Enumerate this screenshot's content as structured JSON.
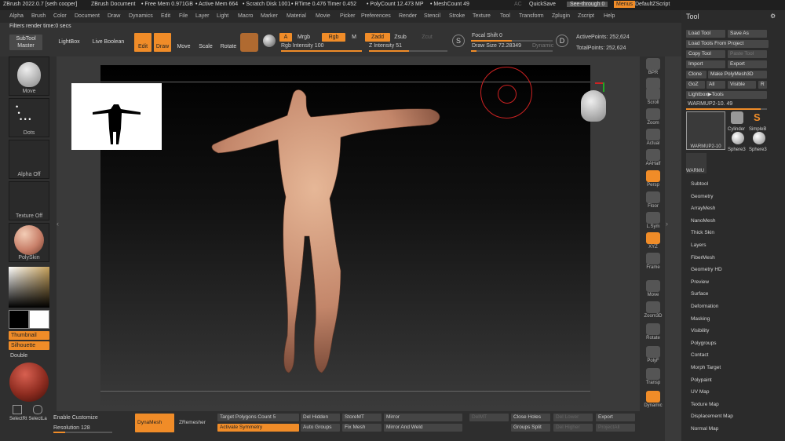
{
  "titlebar": {
    "app": "ZBrush 2022.0.7 [seth cooper]",
    "doc": "ZBrush Document",
    "free_mem": "• Free Mem 0.971GB",
    "active_mem": "• Active Mem 664",
    "scratch": "• Scratch Disk 1001",
    "rtime": "• RTime 0.476 Timer 0.452",
    "polycount": "• PolyCount 12.473 MP",
    "meshcount": "• MeshCount 49",
    "ac": "AC",
    "quicksave": "QuickSave",
    "seethrough": "See-through  0",
    "menus": "Menus",
    "defaultzscript": "DefaultZScript"
  },
  "menu": [
    "Alpha",
    "Brush",
    "Color",
    "Document",
    "Draw",
    "Dynamics",
    "Edit",
    "File",
    "Layer",
    "Light",
    "Macro",
    "Marker",
    "Material",
    "Movie",
    "Picker",
    "Preferences",
    "Render",
    "Stencil",
    "Stroke",
    "Texture",
    "Tool",
    "Transform",
    "Zplugin",
    "Zscript",
    "Help"
  ],
  "status": "Filters render time:0 secs",
  "toolbar": {
    "subtool_master": "SubTool Master",
    "lightbox": "LightBox",
    "live_boolean": "Live Boolean",
    "edit": "Edit",
    "draw": "Draw",
    "move": "Move",
    "scale": "Scale",
    "rotate": "Rotate",
    "a": "A",
    "mrgb": "Mrgb",
    "rgb": "Rgb",
    "m": "M",
    "zadd": "Zadd",
    "zsub": "Zsub",
    "zcut": "Zcut",
    "rgb_intensity": "Rgb Intensity  100",
    "z_intensity": "Z Intensity  51",
    "focal_shift": "Focal Shift  0",
    "draw_size": "Draw Size  72.28349",
    "dynamic": "Dynamic",
    "active_points": "ActivePoints: 252,624",
    "total_points": "TotalPoints: 252,624"
  },
  "left": {
    "brush": "Move",
    "stroke": "Dots",
    "alpha": "Alpha Off",
    "texture": "Texture Off",
    "material": "PolySkin",
    "thumbnail": "Thumbnail",
    "silhouette": "Silhouette",
    "double": "Double",
    "select": "SelectRt SelectLa"
  },
  "right_tools": [
    "BPR",
    "SPix 3",
    "Scroll",
    "Zoom",
    "Actual",
    "AAHalf",
    "Persp",
    "Floor",
    "L.Sym",
    "XYZ",
    "Frame",
    "Move",
    "Zoom3D",
    "Rotate",
    "PolyF",
    "Transp",
    "Dynamic"
  ],
  "toolpanel": {
    "title": "Tool",
    "load_tool": "Load Tool",
    "save_as": "Save As",
    "load_from_project": "Load Tools From Project",
    "copy_tool": "Copy Tool",
    "paste_tool": "Paste Tool",
    "import": "Import",
    "export": "Export",
    "clone": "Clone",
    "make_polymesh": "Make PolyMesh3D",
    "goz": "GoZ",
    "all": "All",
    "visible": "Visible",
    "r": "R",
    "lightbox_tools": "Lightbox▶Tools",
    "current": "WARMUP2-10. 49",
    "thumbs": [
      "WARMUP2-10",
      "Cylinder",
      "SimpleB",
      "Sphere3",
      "Sphere3",
      "WARMU"
    ],
    "sections": [
      "Subtool",
      "Geometry",
      "ArrayMesh",
      "NanoMesh",
      "Thick Skin",
      "Layers",
      "FiberMesh",
      "Geometry HD",
      "Preview",
      "Surface",
      "Deformation",
      "Masking",
      "Visibility",
      "Polygroups",
      "Contact",
      "Morph Target",
      "Polypaint",
      "UV Map",
      "Texture Map",
      "Displacement Map",
      "Normal Map"
    ]
  },
  "bottom": {
    "enable_customize": "Enable Customize",
    "resolution": "Resolution  128",
    "dynamesh": "DynaMesh",
    "zremesher": "ZRemesher",
    "target_polys": "Target Polygons Count  5",
    "activate_symmetry": "Activate Symmetry",
    "del_hidden": "Del Hidden",
    "auto_groups": "Auto Groups",
    "storemt": "StoreMT",
    "fix_mesh": "Fix Mesh",
    "mirror": "Mirror",
    "mirror_weld": "Mirror And Weld",
    "delmt": "DelMT",
    "close_holes": "Close Holes",
    "groups_split": "Groups Split",
    "del_lower": "Del Lower",
    "del_higher": "Del Higher",
    "export": "Export",
    "project_all": "ProjectAll"
  },
  "colors": {
    "accent": "#f08c28",
    "skin": "#d29a7a",
    "bg": "#3a3a3a"
  }
}
